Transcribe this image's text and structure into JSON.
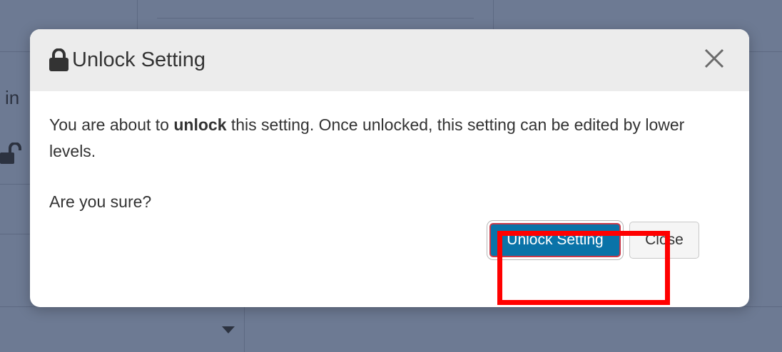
{
  "background": {
    "partial_text": "l in"
  },
  "modal": {
    "title": "Unlock Setting",
    "close_glyph": "×",
    "body": {
      "line1_before": "You are about to ",
      "line1_bold": "unlock",
      "line1_after": " this setting. Once unlocked, this setting can be edited by lower levels.",
      "question": "Are you sure?"
    },
    "buttons": {
      "confirm_label": "Unlock Setting",
      "close_label": "Close"
    }
  },
  "colors": {
    "overlay": "#6d7a93",
    "primary_button": "#0a73a8",
    "highlight": "#ff0000"
  },
  "icons": [
    "lock-icon",
    "unlock-icon",
    "close-icon",
    "caret-down-icon"
  ]
}
